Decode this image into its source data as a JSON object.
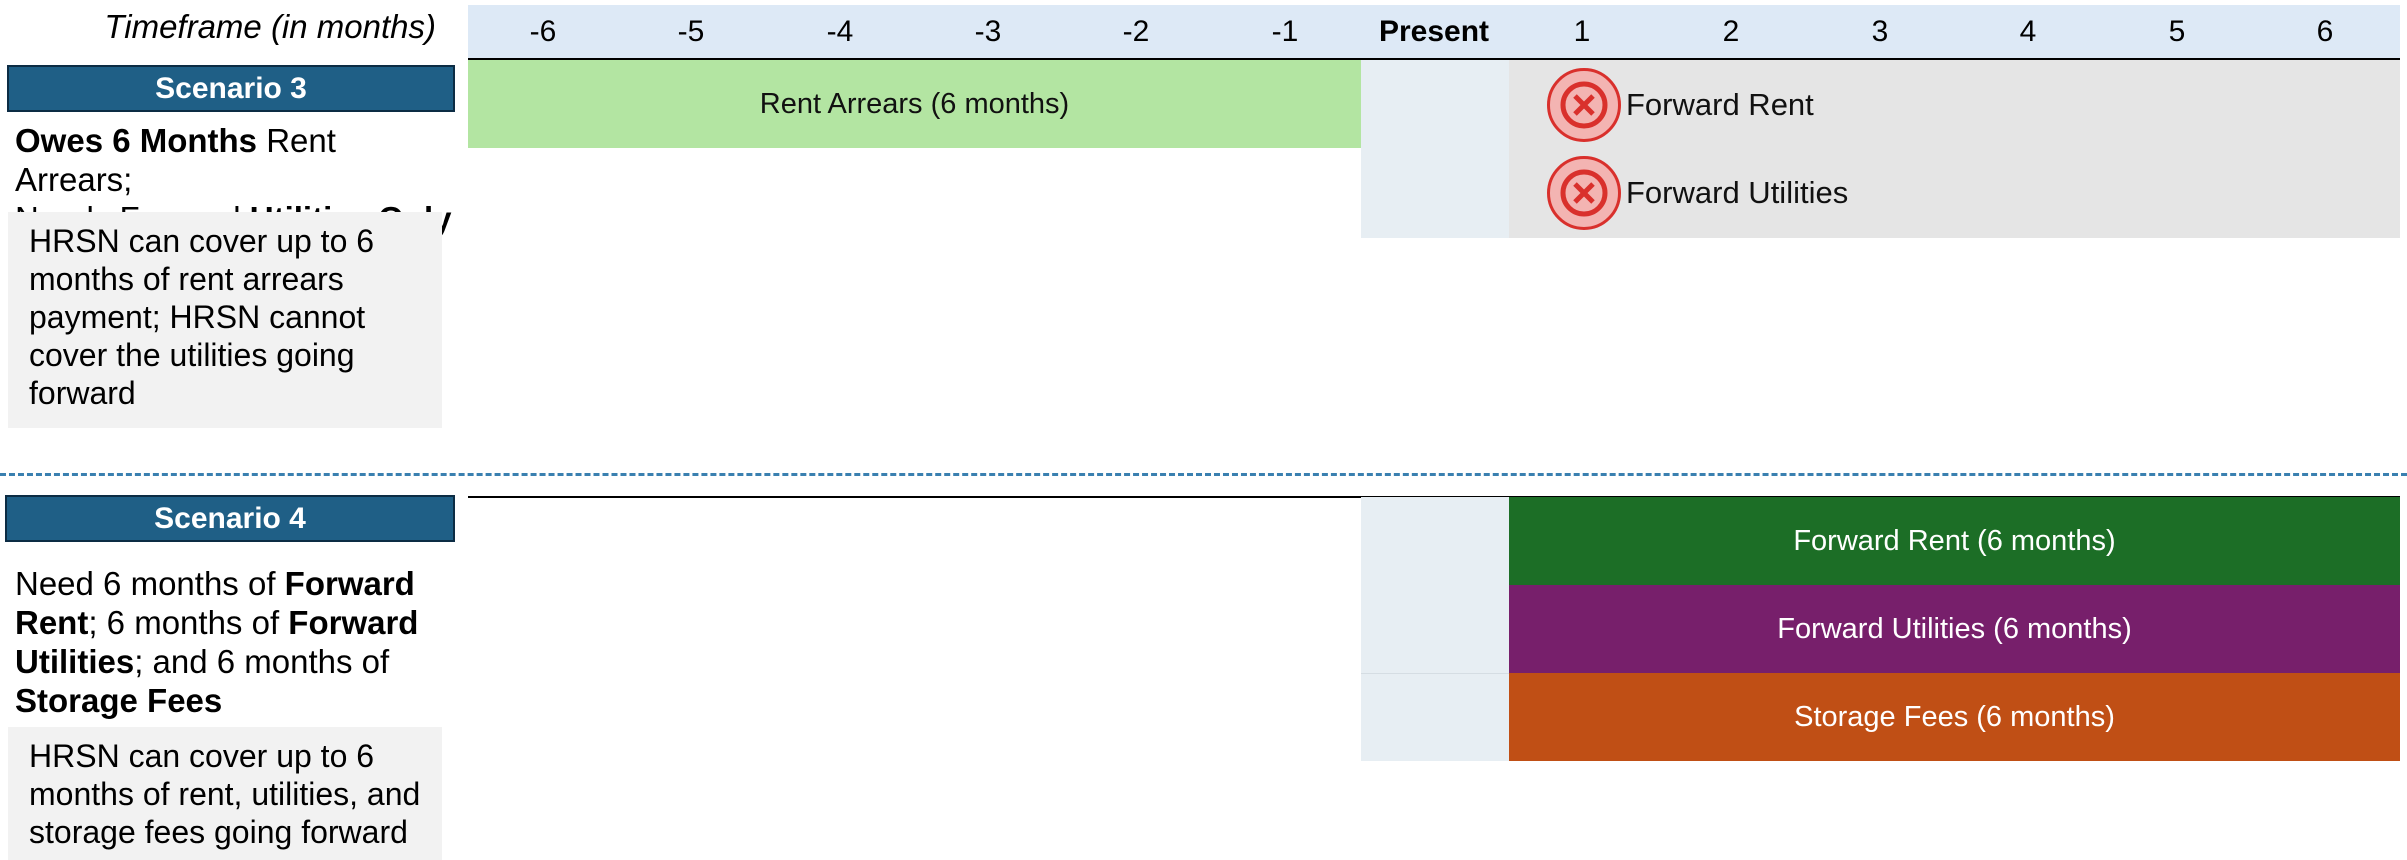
{
  "timeline": {
    "label": "Timeframe (in months)",
    "ticks": [
      "-6",
      "-5",
      "-4",
      "-3",
      "-2",
      "-1",
      "Present",
      "1",
      "2",
      "3",
      "4",
      "5",
      "6"
    ]
  },
  "scenario3": {
    "title": "Scenario 3",
    "desc_bold1": "Owes 6 Months",
    "desc_text1": " Rent Arrears;",
    "desc_text2": "Needs Forward ",
    "desc_bold2": "Utilities Only",
    "note": "HRSN can cover up to 6 months of rent arrears payment; HRSN cannot cover the utilities going forward",
    "arrears_bar": "Rent Arrears (6 months)",
    "not_covered": [
      "Forward Rent",
      "Forward Utilities"
    ]
  },
  "scenario4": {
    "title": "Scenario 4",
    "desc_t1": "Need 6 months of ",
    "desc_b1": "Forward Rent",
    "desc_t2": "; 6 months of ",
    "desc_b2": "Forward Utilities",
    "desc_t3": "; and 6 months of ",
    "desc_b3": "Storage Fees",
    "note": "HRSN can cover up to 6 months of rent, utilities, and storage fees going forward",
    "bars": [
      {
        "label": "Forward Rent (6 months)",
        "color": "#1c6e26"
      },
      {
        "label": "Forward Utilities (6 months)",
        "color": "#771f6b"
      },
      {
        "label": "Storage Fees (6 months)",
        "color": "#c04f15"
      }
    ]
  },
  "colors": {
    "scenario_header": "#1f5f86",
    "arrears_bar": "#b3e5a2",
    "not_covered_icon": "#d9302c",
    "divider": "#3a80b0"
  }
}
